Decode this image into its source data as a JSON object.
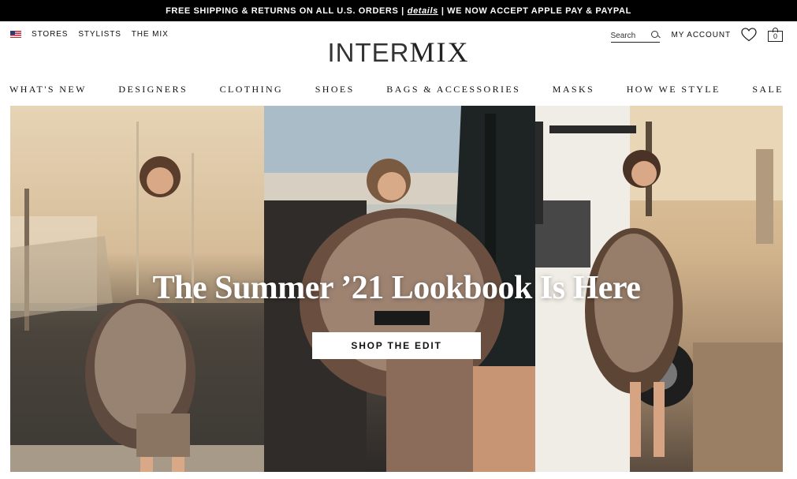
{
  "promo": {
    "text_before": "FREE SHIPPING & RETURNS ON ALL U.S. ORDERS |",
    "details_link": "details",
    "text_after": "| WE NOW ACCEPT APPLE PAY & PAYPAL"
  },
  "utility": {
    "flag_icon": "us-flag-icon",
    "links": [
      "STORES",
      "STYLISTS",
      "THE MIX"
    ],
    "search_placeholder": "Search",
    "my_account": "MY ACCOUNT",
    "bag_count": "0"
  },
  "brand": {
    "logo_part_1": "INTER",
    "logo_part_2": "MIX"
  },
  "nav": {
    "items": [
      "WHAT'S NEW",
      "DESIGNERS",
      "CLOTHING",
      "SHOES",
      "BAGS & ACCESSORIES",
      "MASKS",
      "HOW WE STYLE",
      "SALE"
    ]
  },
  "hero": {
    "title": "The Summer ’21 Lookbook Is Here",
    "cta": "SHOP THE EDIT"
  },
  "colors": {
    "promo_bg": "#000000",
    "text": "#111111",
    "button_bg": "#ffffff"
  }
}
